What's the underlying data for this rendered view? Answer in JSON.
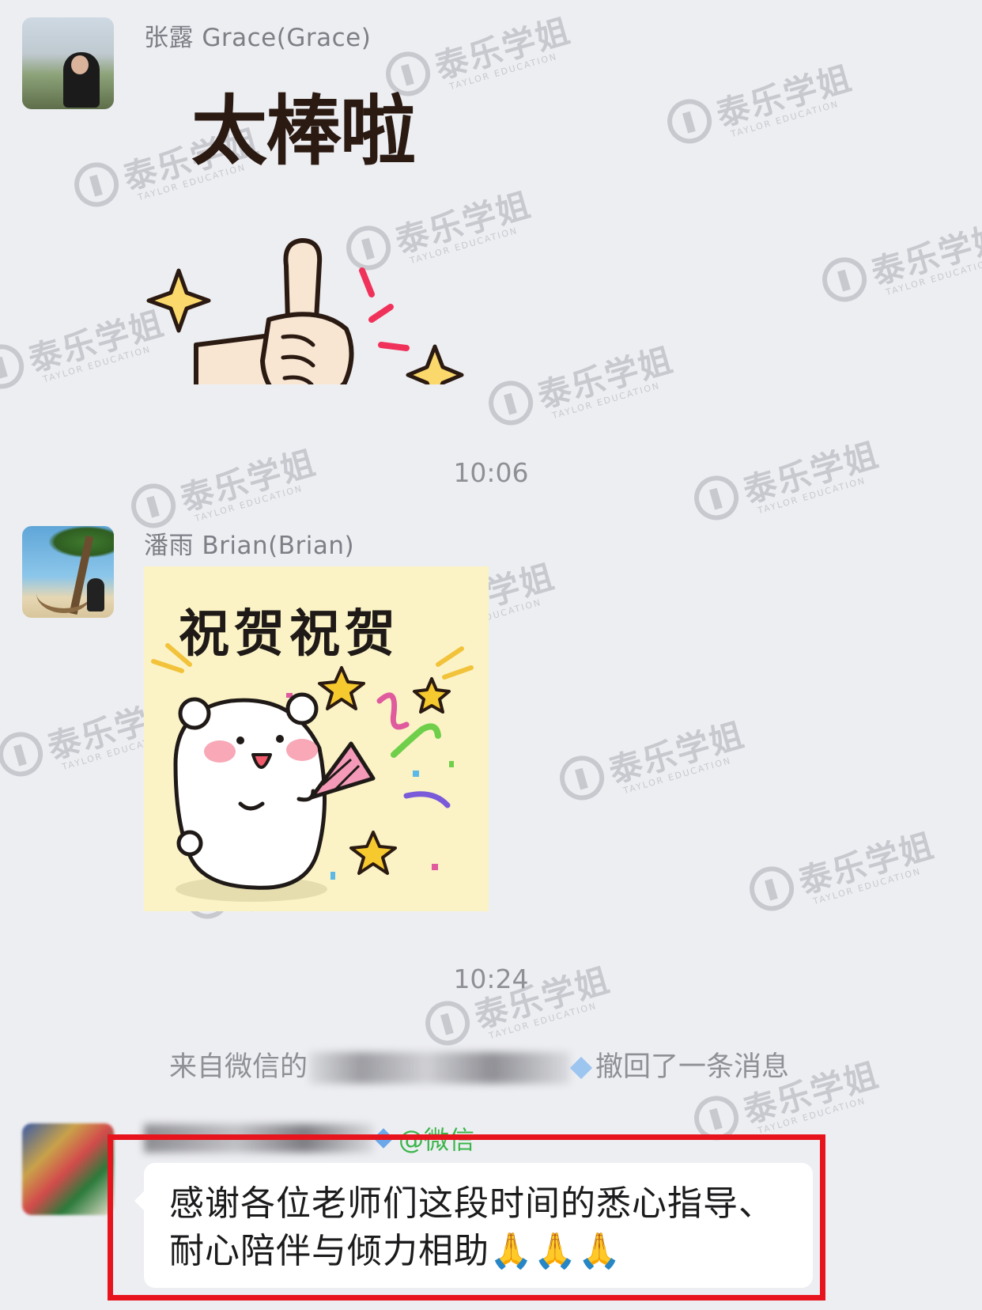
{
  "messages": [
    {
      "sender": "张露 Grace(Grace)",
      "avatar_icon": "profile-photo-grace",
      "sticker": {
        "caption": "太棒啦",
        "icon": "thumbs-up-sticker"
      }
    },
    {
      "timestamp": "10:06"
    },
    {
      "sender": "潘雨 Brian(Brian)",
      "avatar_icon": "profile-photo-brian",
      "sticker": {
        "caption": "祝贺祝贺",
        "icon": "celebrating-bear-sticker"
      }
    },
    {
      "timestamp": "10:24"
    },
    {
      "system_notice": {
        "prefix": "来自微信的",
        "suffix": "撤回了一条消息"
      }
    },
    {
      "source_tag": "@微信",
      "text": "感谢各位老师们这段时间的悉心指导、耐心陪伴与倾力相助🙏🙏🙏"
    }
  ],
  "watermark": {
    "brand": "泰乐学姐",
    "sub": "TAYLOR EDUCATION"
  },
  "colors": {
    "background": "#EDEEF2",
    "bubble": "#FFFFFF",
    "highlight": "#E8141D",
    "source_tag": "#3BB54A",
    "meta_text": "#8E9096"
  }
}
